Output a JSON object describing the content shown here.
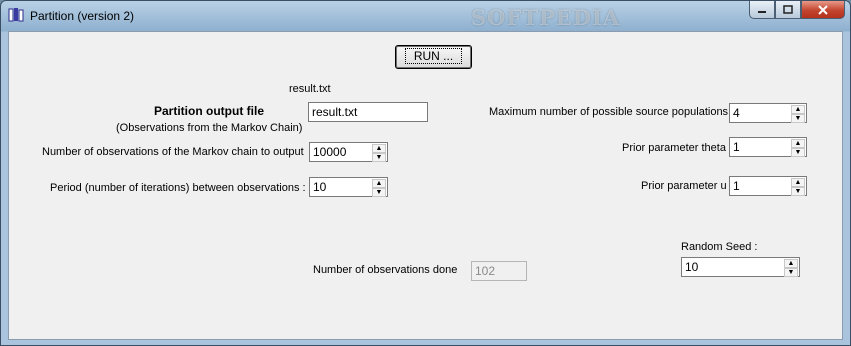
{
  "window": {
    "title": "Partition (version 2)",
    "watermark": "SOFTPEDIA"
  },
  "run_button": {
    "label": "RUN ..."
  },
  "output_file": {
    "path_display": "result.txt",
    "label": "Partition output file",
    "sublabel": "(Observations from the Markov Chain)",
    "value": "result.txt"
  },
  "num_observations": {
    "label": "Number of observations of the Markov chain to output",
    "value": "10000"
  },
  "period": {
    "label": "Period (number of iterations) between observations :",
    "value": "10"
  },
  "max_populations": {
    "label": "Maximum number of possible source populations",
    "value": "4"
  },
  "prior_theta": {
    "label": "Prior parameter theta",
    "value": "1"
  },
  "prior_u": {
    "label": "Prior parameter u",
    "value": "1"
  },
  "random_seed": {
    "label": "Random Seed :",
    "value": "10"
  },
  "observations_done": {
    "label": "Number of observations done",
    "value": "102"
  }
}
